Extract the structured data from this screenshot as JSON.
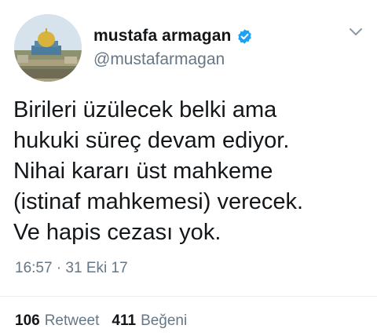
{
  "user": {
    "display_name": "mustafa armagan",
    "handle": "@mustafarmagan",
    "verified": true,
    "verified_color": "#1da1f2"
  },
  "tweet": {
    "text": "Birileri üzülecek belki ama\nhukuki süreç devam ediyor.\nNihai kararı üst mahkeme\n(istinaf mahkemesi) verecek.\nVe hapis cezası yok.",
    "timestamp": "16:57 · 31 Eki 17"
  },
  "stats": {
    "retweets_count": "106",
    "retweets_label": "Retweet",
    "likes_count": "411",
    "likes_label": "Beğeni"
  },
  "icons": {
    "avatar": "dome-of-the-rock-photo",
    "verified": "verified-badge-icon",
    "menu": "chevron-down-icon"
  },
  "colors": {
    "text_primary": "#14171a",
    "text_secondary": "#657786",
    "divider": "#e6ecf0"
  }
}
